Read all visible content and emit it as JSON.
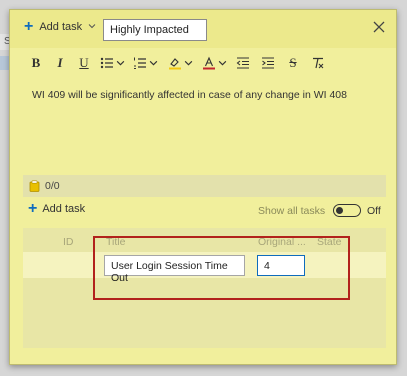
{
  "header": {
    "add_task_label": "Add task",
    "title_value": "Highly Impacted"
  },
  "toolbar": {
    "bold": "B",
    "italic": "I",
    "underline": "U",
    "strike": "S"
  },
  "editor": {
    "text": "WI 409 will be significantly affected in case of any change in WI 408"
  },
  "attachments": {
    "count": "0/0"
  },
  "tasks": {
    "add_task_label": "Add task",
    "show_all_label": "Show all tasks",
    "toggle_state": "Off"
  },
  "grid": {
    "columns": [
      "ID",
      "Title",
      "Original ...",
      "State"
    ],
    "rows": [
      {
        "title": "User Login Session Time Out",
        "original_estimate": "4"
      }
    ]
  },
  "colors": {
    "dialog_bg": "#f1ef9c",
    "accent": "#0f6cbd",
    "highlight": "#b2221c"
  }
}
